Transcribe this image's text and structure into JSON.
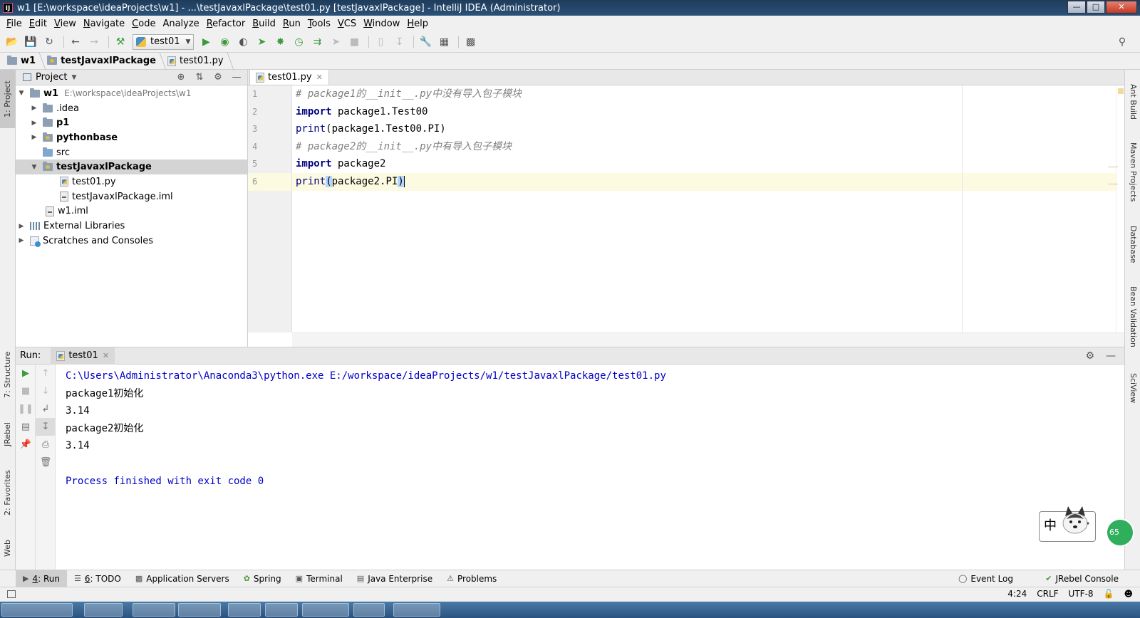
{
  "window": {
    "title": "w1 [E:\\workspace\\ideaProjects\\w1] - ...\\testJavaxlPackage\\test01.py [testJavaxlPackage] - IntelliJ IDEA (Administrator)"
  },
  "menu": {
    "items": [
      {
        "key": "F",
        "rest": "ile"
      },
      {
        "key": "E",
        "rest": "dit"
      },
      {
        "key": "V",
        "rest": "iew"
      },
      {
        "key": "N",
        "rest": "avigate"
      },
      {
        "key": "C",
        "rest": "ode"
      },
      {
        "key": "",
        "rest": "Analyze"
      },
      {
        "key": "R",
        "rest": "efactor"
      },
      {
        "key": "B",
        "rest": "uild"
      },
      {
        "key": "R",
        "rest": "un"
      },
      {
        "key": "T",
        "rest": "ools"
      },
      {
        "key": "V",
        "rest": "CS"
      },
      {
        "key": "W",
        "rest": "indow"
      },
      {
        "key": "H",
        "rest": "elp"
      }
    ]
  },
  "toolbar": {
    "run_config": "test01"
  },
  "breadcrumb": {
    "items": [
      "w1",
      "testJavaxlPackage",
      "test01.py"
    ]
  },
  "left_strip": {
    "project": "1: Project",
    "structure": "7: Structure",
    "jrebel": "JRebel",
    "favorites": "2: Favorites",
    "web": "Web"
  },
  "right_strip": {
    "ant": "Ant Build",
    "maven": "Maven Projects",
    "database": "Database",
    "bean": "Bean Validation",
    "sciview": "SciView"
  },
  "project_panel": {
    "title": "Project",
    "tree": {
      "root": "w1",
      "root_path": "E:\\workspace\\ideaProjects\\w1",
      "idea": ".idea",
      "p1": "p1",
      "pythonbase": "pythonbase",
      "src": "src",
      "pkg": "testJavaxlPackage",
      "test01": "test01.py",
      "pkg_iml": "testJavaxlPackage.iml",
      "w1_iml": "w1.iml",
      "ext_libs": "External Libraries",
      "scratches": "Scratches and Consoles"
    }
  },
  "editor": {
    "tab": "test01.py",
    "line_numbers": [
      "1",
      "2",
      "3",
      "4",
      "5",
      "6"
    ],
    "code": {
      "l1": "# package1的__init__.py中没有导入包子模块",
      "l2_kw": "import",
      "l2_rest": " package1.Test00",
      "l3_fn": "print",
      "l3_rest": "(package1.Test00.PI)",
      "l4": "# package2的__init__.py中有导入包子模块",
      "l5_kw": "import",
      "l5_rest": " package2",
      "l6_fn": "print",
      "l6_open": "(",
      "l6_mid": "package2.PI",
      "l6_close": ")"
    }
  },
  "run_panel": {
    "label": "Run:",
    "tab": "test01",
    "output": [
      "C:\\Users\\Administrator\\Anaconda3\\python.exe E:/workspace/ideaProjects/w1/testJavaxlPackage/test01.py",
      "package1初始化",
      "3.14",
      "package2初始化",
      "3.14",
      "",
      "Process finished with exit code 0"
    ]
  },
  "ime": {
    "label": "中",
    "badge": "65"
  },
  "tool_buttons": {
    "run_key": "4",
    "run_rest": ": Run",
    "todo_key": "6",
    "todo_rest": ": TODO",
    "app_servers": "Application Servers",
    "spring": "Spring",
    "terminal": "Terminal",
    "java_enterprise": "Java Enterprise",
    "problems": "Problems",
    "event_log": "Event Log",
    "jrebel_console": "JRebel Console"
  },
  "status_bar": {
    "position": "4:24",
    "line_sep": "CRLF",
    "encoding": "UTF-8"
  }
}
